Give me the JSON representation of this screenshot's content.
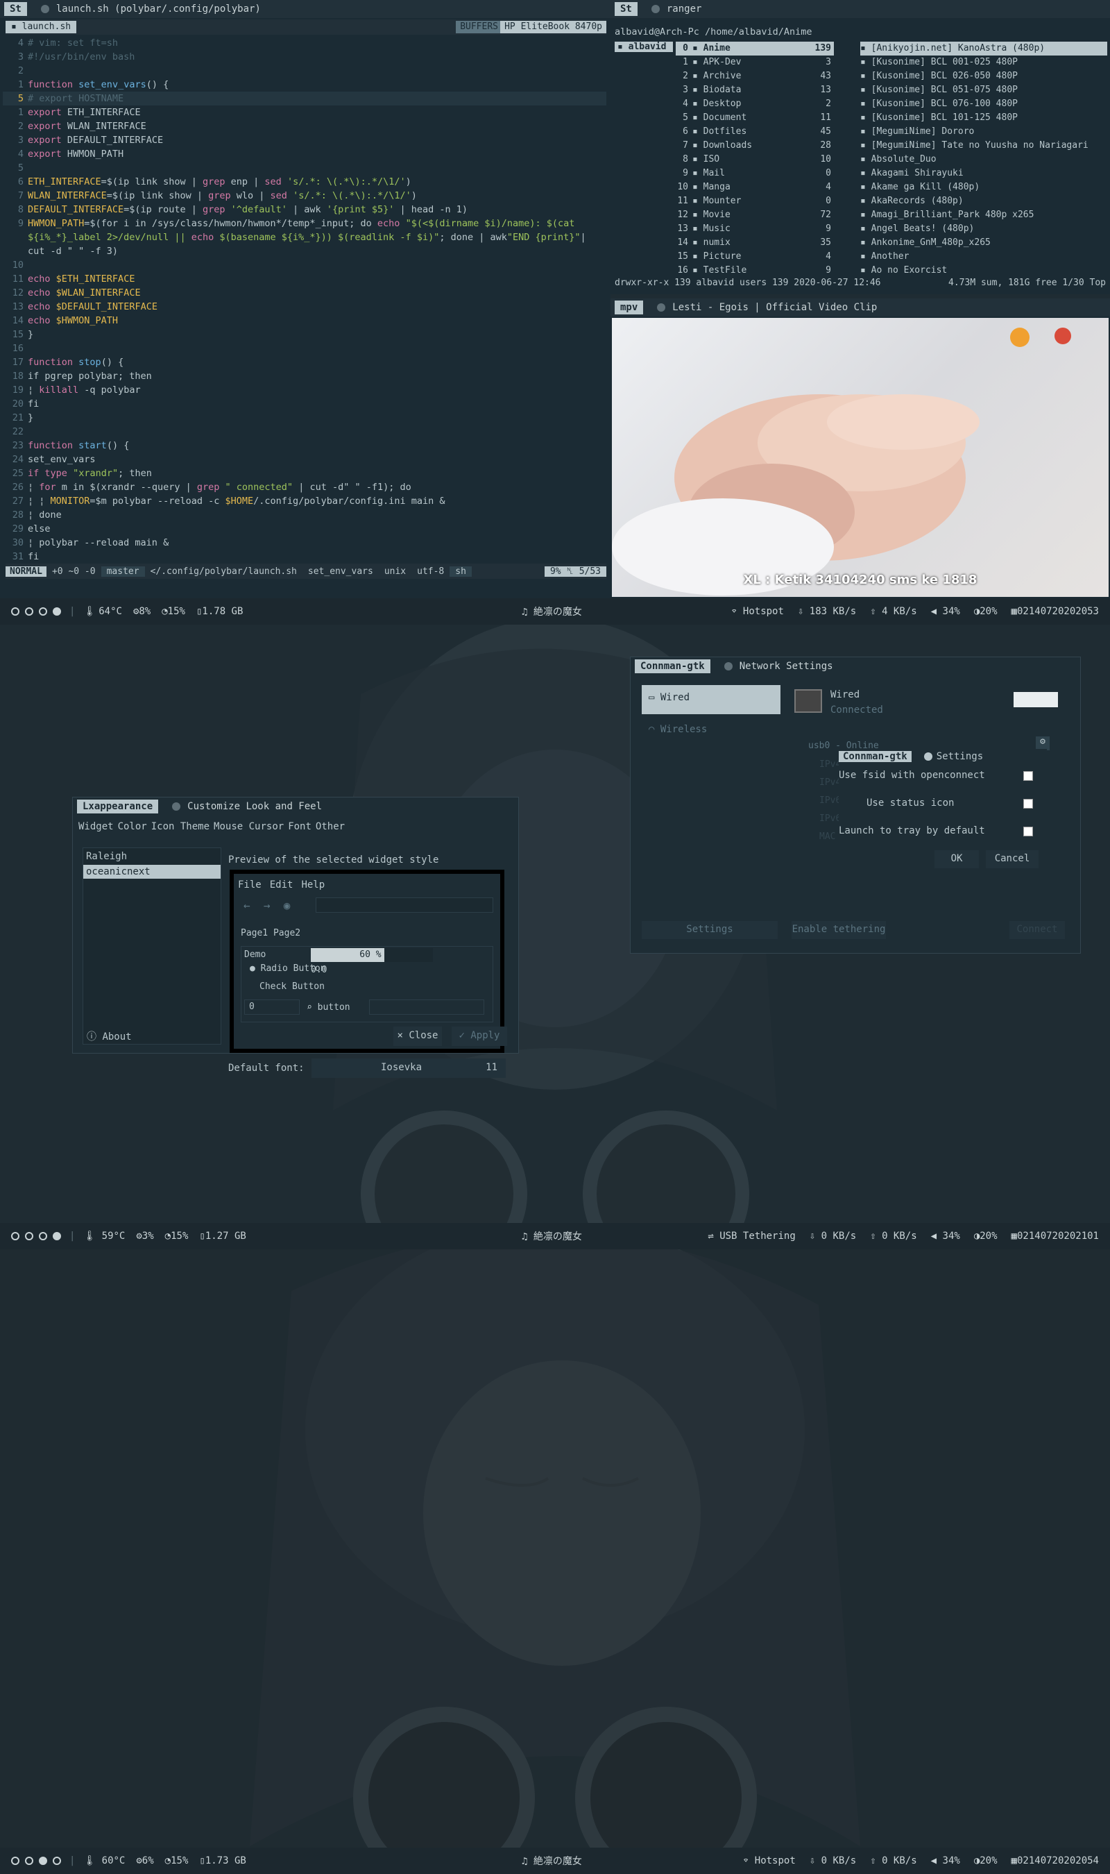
{
  "screens": [
    {
      "bar": {
        "temp": "64°C",
        "cpu": "8%",
        "mem": "15%",
        "ram": "1.78 GB",
        "song": "絶凛の魔女",
        "net": "Hotspot",
        "down": "183 KB/s",
        "up": "4 KB/s",
        "vol": "34%",
        "bright": "20%",
        "date": "02140720202053"
      }
    },
    {
      "bar": {
        "temp": "59°C",
        "cpu": "3%",
        "mem": "15%",
        "ram": "1.27 GB",
        "song": "絶凛の魔女",
        "net": "USB Tethering",
        "down": "0 KB/s",
        "up": "0 KB/s",
        "vol": "34%",
        "bright": "20%",
        "date": "02140720202101"
      }
    },
    {
      "bar": {
        "temp": "60°C",
        "cpu": "6%",
        "mem": "15%",
        "ram": "1.73 GB",
        "song": "絶凛の魔女",
        "net": "Hotspot",
        "down": "0 KB/s",
        "up": "0 KB/s",
        "vol": "34%",
        "bright": "20%",
        "date": "02140720202054"
      }
    }
  ],
  "vim": {
    "tag": "St",
    "title": "launch.sh (polybar/.config/polybar)",
    "buffer": "launch.sh",
    "buffers_label": "BUFFERS",
    "host_label": "HP EliteBook 8470p",
    "status": {
      "mode": "NORMAL",
      "diff": "+0 ~0 -0",
      "branch": "master",
      "path": "</.config/polybar/launch.sh",
      "func": "set_env_vars",
      "format": "unix",
      "enc": "utf-8",
      "ft": "sh",
      "pos": "9% ␤ 5/53"
    }
  },
  "ranger": {
    "tag": "St",
    "title": "ranger",
    "path": "albavid@Arch-Pc /home/albavid/Anime",
    "left": "albavid",
    "dirs": [
      {
        "n": "0",
        "name": "Anime",
        "c": "139"
      },
      {
        "n": "1",
        "name": "APK-Dev",
        "c": "3"
      },
      {
        "n": "2",
        "name": "Archive",
        "c": "43"
      },
      {
        "n": "3",
        "name": "Biodata",
        "c": "13"
      },
      {
        "n": "4",
        "name": "Desktop",
        "c": "2"
      },
      {
        "n": "5",
        "name": "Document",
        "c": "11"
      },
      {
        "n": "6",
        "name": "Dotfiles",
        "c": "45"
      },
      {
        "n": "7",
        "name": "Downloads",
        "c": "28"
      },
      {
        "n": "8",
        "name": "ISO",
        "c": "10"
      },
      {
        "n": "9",
        "name": "Mail",
        "c": "0"
      },
      {
        "n": "10",
        "name": "Manga",
        "c": "4"
      },
      {
        "n": "11",
        "name": "Mounter",
        "c": "0"
      },
      {
        "n": "12",
        "name": "Movie",
        "c": "72"
      },
      {
        "n": "13",
        "name": "Music",
        "c": "9"
      },
      {
        "n": "14",
        "name": "numix",
        "c": "35"
      },
      {
        "n": "15",
        "name": "Picture",
        "c": "4"
      },
      {
        "n": "16",
        "name": "TestFile",
        "c": "9"
      }
    ],
    "files": [
      "[Anikyojin.net] KanoAstra (480p)",
      "[Kusonime] BCL 001-025 480P",
      "[Kusonime] BCL 026-050 480P",
      "[Kusonime] BCL 051-075 480P",
      "[Kusonime] BCL 076-100 480P",
      "[Kusonime] BCL 101-125 480P",
      "[MegumiNime] Dororo",
      "[MegumiNime] Tate no Yuusha no Nariagari",
      "Absolute_Duo",
      "Akagami Shirayuki",
      "Akame ga Kill (480p)",
      "AkaRecords (480p)",
      "Amagi_Brilliant_Park 480p x265",
      "Angel Beats! (480p)",
      "Ankonime_GnM_480p_x265",
      "Another",
      "Ao no Exorcist"
    ],
    "footer_left": "drwxr-xr-x 139 albavid users 139 2020-06-27 12:46",
    "footer_right": "4.73M sum, 181G free  1/30  Top"
  },
  "mpv": {
    "tag": "mpv",
    "title": "Lesti - Egois | Official Video Clip",
    "caption": "XL : Ketik 34104240 sms ke 1818"
  },
  "lxappearance": {
    "tag": "Lxappearance",
    "title": "Customize Look and Feel",
    "tabs": [
      "Widget",
      "Color",
      "Icon Theme",
      "Mouse Cursor",
      "Font",
      "Other"
    ],
    "themes": [
      "Raleigh",
      "oceanicnext"
    ],
    "preview_label": "Preview of the selected widget style",
    "menu": [
      "File",
      "Edit",
      "Help"
    ],
    "pages": [
      "Page1",
      "Page2"
    ],
    "demo": "Demo",
    "progress": "60 %",
    "progress_value": 0.6,
    "scale": "0.0",
    "radio": "Radio Button",
    "check": "Check Button",
    "spin": "0",
    "button": "button",
    "font_label": "Default font:",
    "font_name": "Iosevka",
    "font_size": "11",
    "about": "About",
    "close": "Close",
    "apply": "Apply"
  },
  "connman": {
    "tag": "Connman-gtk",
    "title": "Network Settings",
    "wired": "Wired",
    "wireless": "Wireless",
    "conn_title": "Wired",
    "conn_status": "Connected",
    "usb": "usb0 - Online",
    "side": [
      "IPv4",
      "IPv4",
      "IPv6",
      "IPv6",
      "MAC"
    ],
    "settings_btn": "Settings",
    "tether_btn": "Enable tethering",
    "connect_btn": "Connect",
    "dialog": {
      "tag": "Connman-gtk",
      "title": "Settings",
      "opt1": "Use fsid with openconnect",
      "opt2": "Use status icon",
      "opt3": "Launch to tray by default",
      "ok": "OK",
      "cancel": "Cancel"
    }
  }
}
